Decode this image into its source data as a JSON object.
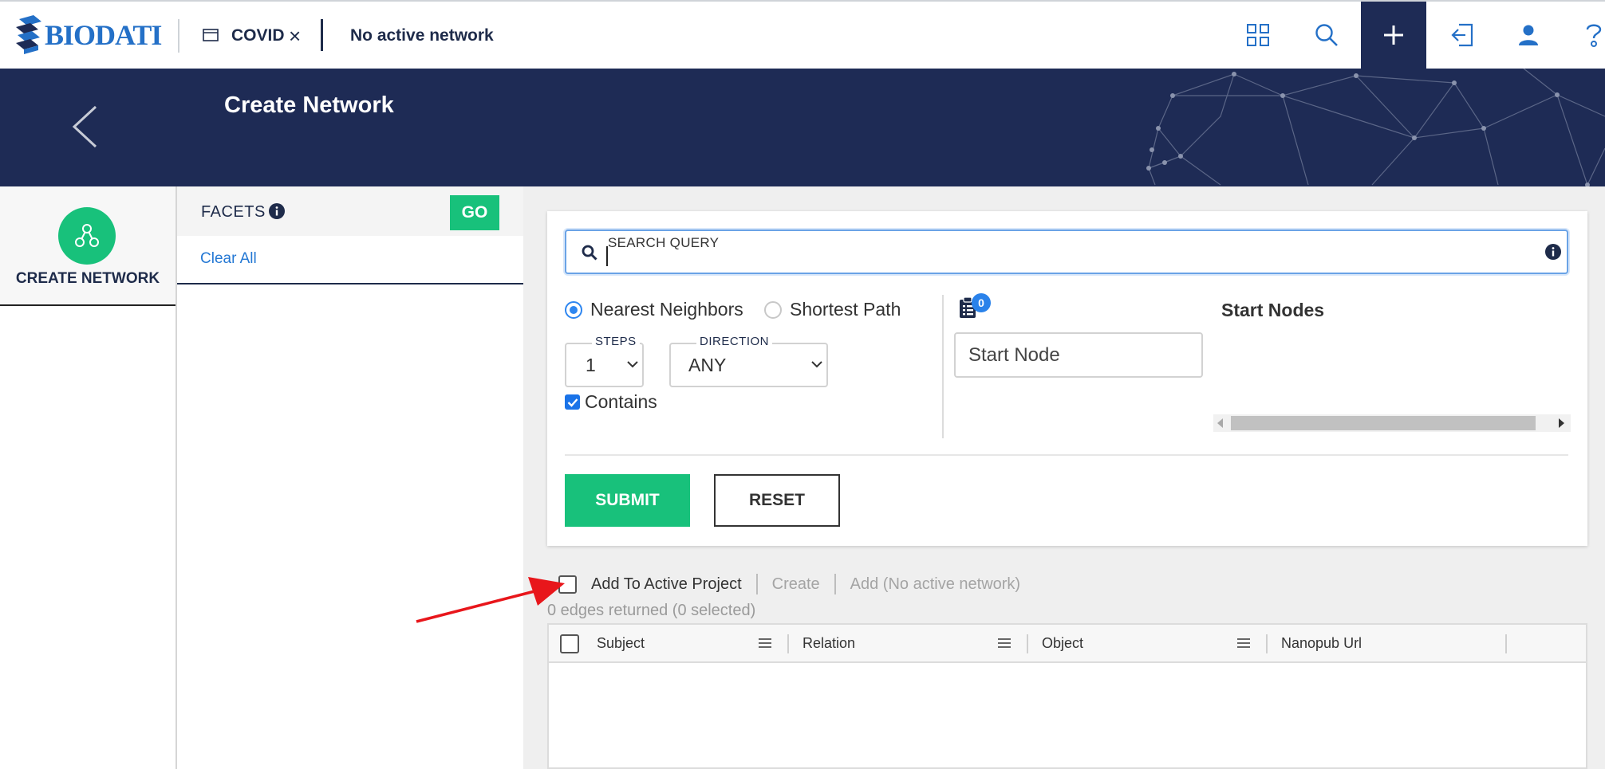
{
  "topbar": {
    "logo_text": "BIODATI",
    "project_name": "COVID",
    "close_glyph": "×",
    "network_status": "No active network",
    "icons": [
      "apps-grid-icon",
      "search-icon",
      "plus-icon",
      "login-icon",
      "user-icon",
      "help-icon"
    ]
  },
  "banner": {
    "title": "Create Network"
  },
  "leftnav": {
    "item_label": "CREATE NETWORK"
  },
  "facets": {
    "title": "FACETS",
    "go_label": "GO",
    "clear_all": "Clear All"
  },
  "query": {
    "search_label": "SEARCH QUERY",
    "search_value": "",
    "mode_options": [
      "Nearest Neighbors",
      "Shortest Path"
    ],
    "mode_selected": "Nearest Neighbors",
    "steps_label": "STEPS",
    "steps_value": "1",
    "direction_label": "DIRECTION",
    "direction_value": "ANY",
    "contains_label": "Contains",
    "contains_checked": true,
    "start_count": "0",
    "start_placeholder": "Start Node",
    "start_nodes_title": "Start Nodes",
    "submit_label": "SUBMIT",
    "reset_label": "RESET"
  },
  "results": {
    "add_to_project": "Add To Active Project",
    "create_label": "Create",
    "add_label": "Add (No active network)",
    "edges_count": "0 edges returned (0 selected)",
    "columns": [
      "Subject",
      "Relation",
      "Object",
      "Nanopub Url"
    ]
  },
  "colors": {
    "navy": "#1e2b55",
    "green": "#18c17b",
    "link_blue": "#2478d4",
    "arrow_red": "#e8161b"
  }
}
